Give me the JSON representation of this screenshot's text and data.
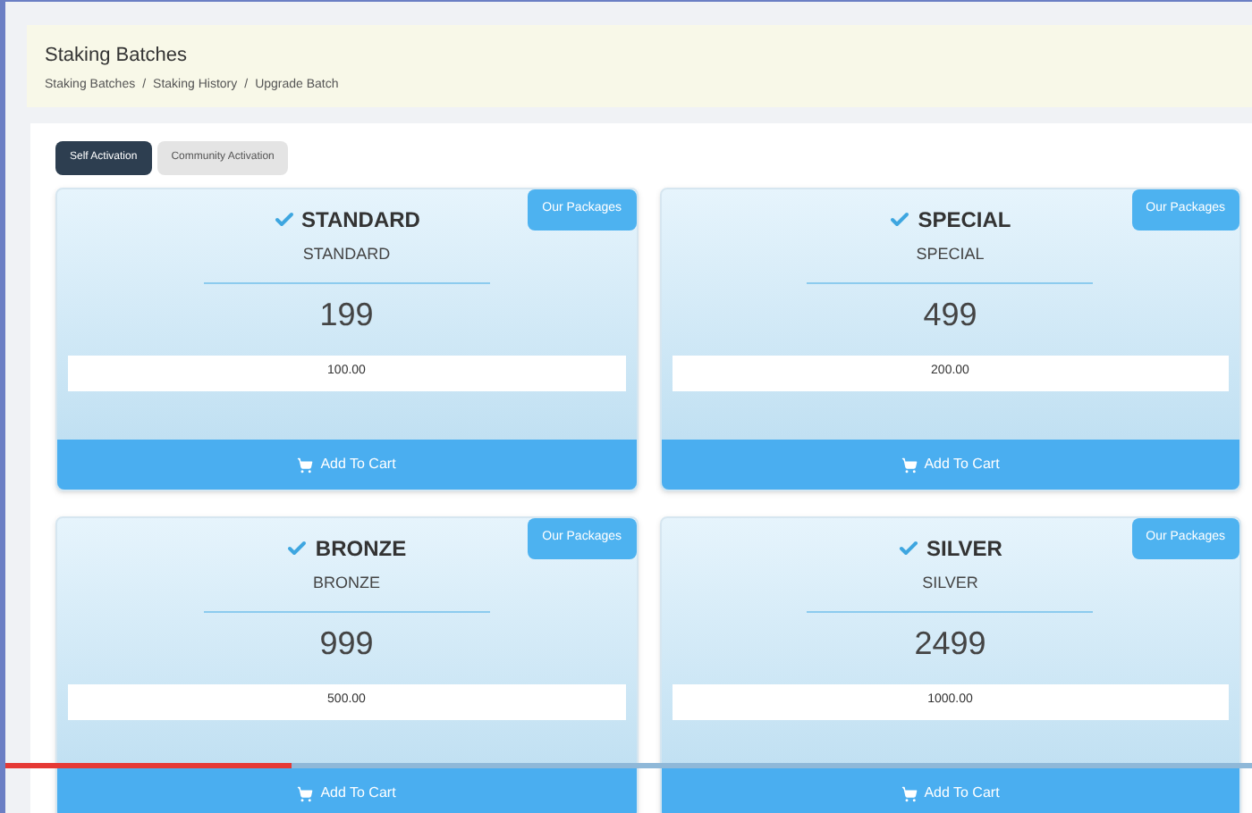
{
  "header": {
    "title": "Staking Batches",
    "breadcrumb": [
      "Staking Batches",
      "Staking History",
      "Upgrade Batch"
    ],
    "separator": "/"
  },
  "tabs": [
    {
      "label": "Self Activation",
      "selected": true
    },
    {
      "label": "Community Activation",
      "selected": false
    }
  ],
  "packages": [
    {
      "badge": "Our Packages",
      "title": "STANDARD",
      "subtitle": "STANDARD",
      "price": "199",
      "amount": "100.00",
      "button": "Add To Cart"
    },
    {
      "badge": "Our Packages",
      "title": "SPECIAL",
      "subtitle": "SPECIAL",
      "price": "499",
      "amount": "200.00",
      "button": "Add To Cart"
    },
    {
      "badge": "Our Packages",
      "title": "BRONZE",
      "subtitle": "BRONZE",
      "price": "999",
      "amount": "500.00",
      "button": "Add To Cart"
    },
    {
      "badge": "Our Packages",
      "title": "SILVER",
      "subtitle": "SILVER",
      "price": "2499",
      "amount": "1000.00",
      "button": "Add To Cart"
    }
  ],
  "video_progress": {
    "level": 0.23
  }
}
